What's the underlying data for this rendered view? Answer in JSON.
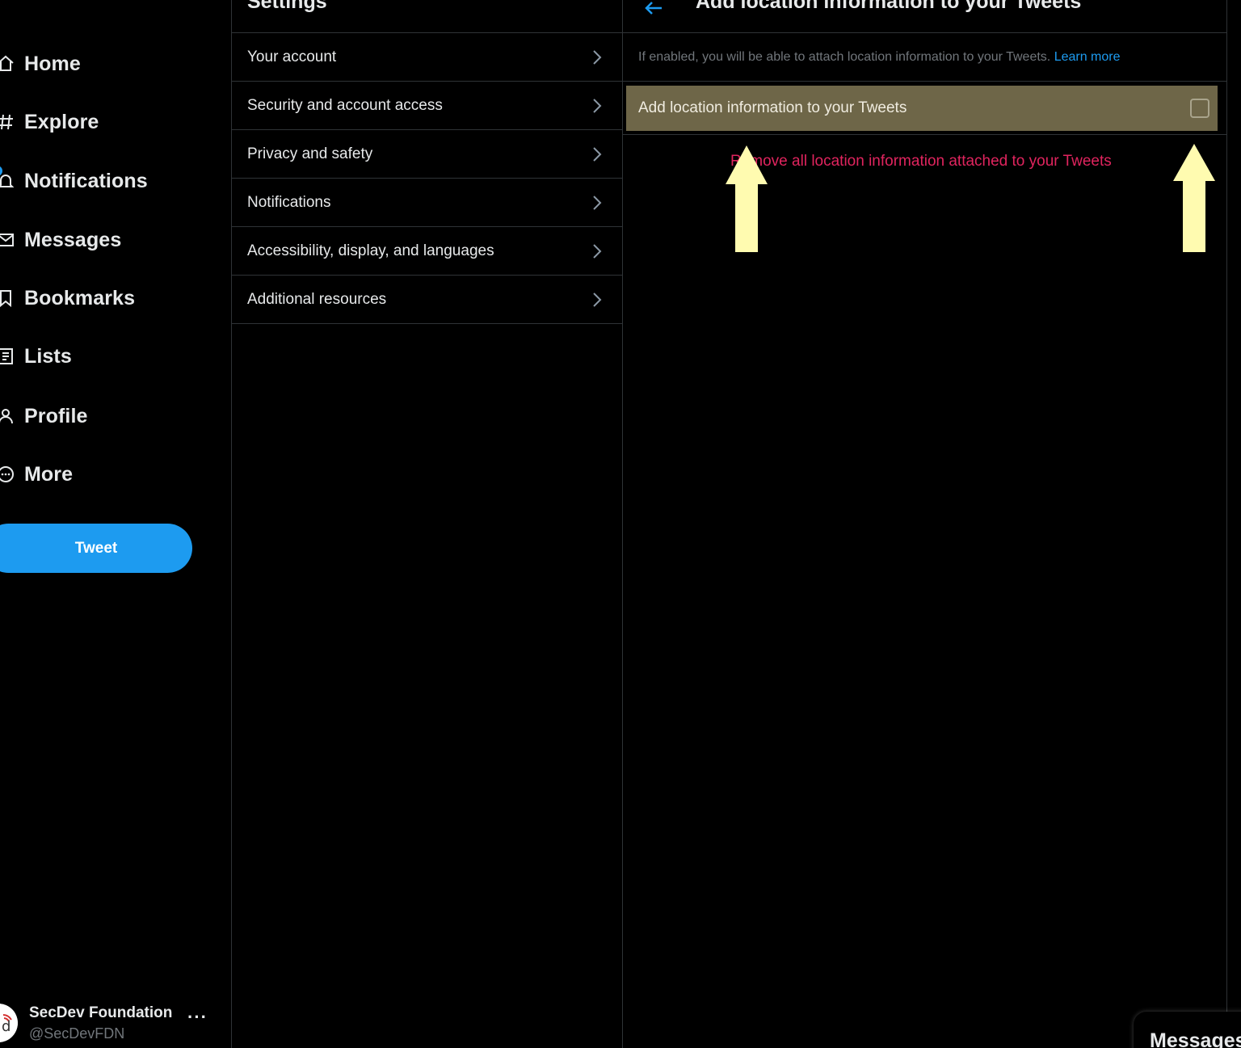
{
  "nav": {
    "items": [
      {
        "label": "Home",
        "icon": "home-icon"
      },
      {
        "label": "Explore",
        "icon": "hashtag-icon"
      },
      {
        "label": "Notifications",
        "icon": "bell-icon"
      },
      {
        "label": "Messages",
        "icon": "envelope-icon"
      },
      {
        "label": "Bookmarks",
        "icon": "bookmark-icon"
      },
      {
        "label": "Lists",
        "icon": "list-icon"
      },
      {
        "label": "Profile",
        "icon": "user-icon"
      },
      {
        "label": "More",
        "icon": "more-circle-icon"
      }
    ],
    "tweet_label": "Tweet",
    "account": {
      "name": "SecDev Foundation",
      "handle": "@SecDevFDN",
      "more": "···"
    }
  },
  "settings": {
    "title": "Settings",
    "items": [
      {
        "label": "Your account"
      },
      {
        "label": "Security and account access"
      },
      {
        "label": "Privacy and safety"
      },
      {
        "label": "Notifications"
      },
      {
        "label": "Accessibility, display, and languages"
      },
      {
        "label": "Additional resources"
      }
    ]
  },
  "detail": {
    "title": "Add location information to your Tweets",
    "description": "If enabled, you will be able to attach location information to your Tweets.",
    "learn_more": "Learn more",
    "toggle_label": "Add location information to your Tweets",
    "toggle_checked": false,
    "remove_label": "Remove all location information attached to your Tweets"
  },
  "messages_drawer": {
    "label": "Messages"
  },
  "colors": {
    "accent": "#1d9bf0",
    "highlight": "#6e6648",
    "danger": "#e0245e",
    "annotation_arrow": "#fffbb0"
  }
}
